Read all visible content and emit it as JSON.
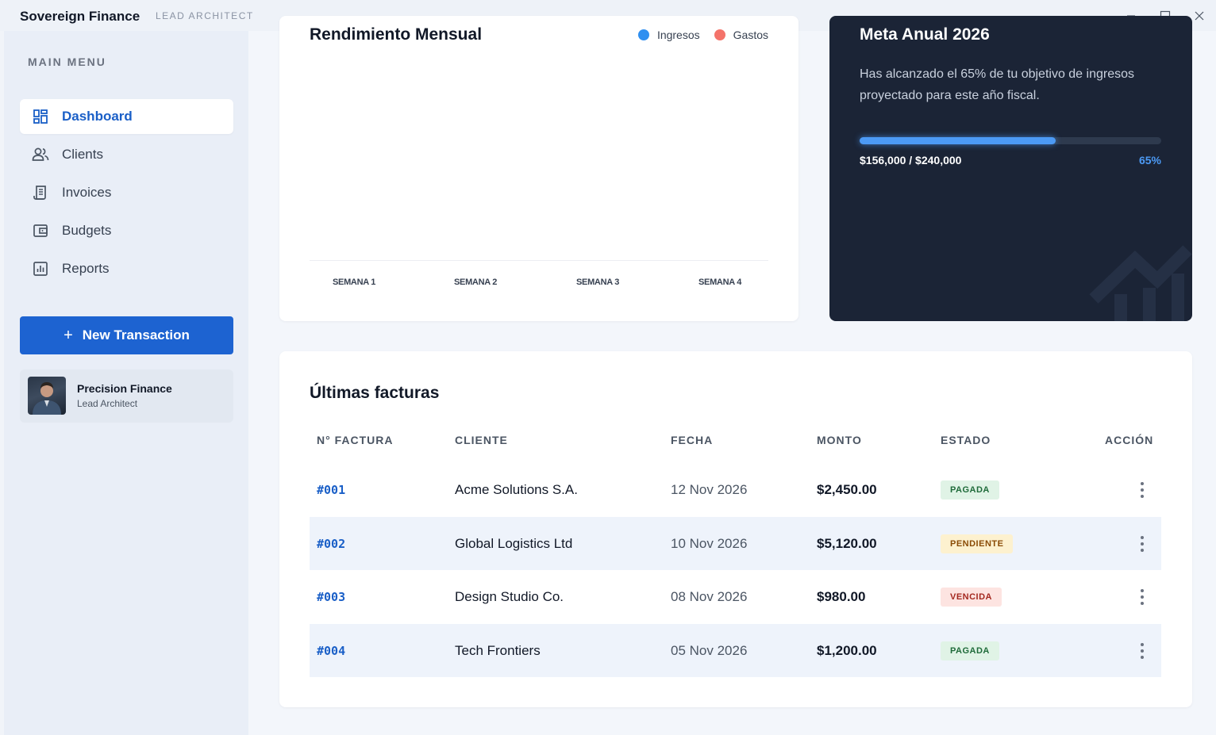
{
  "window": {
    "app_title": "Sovereign Finance",
    "app_subtitle": "LEAD ARCHITECT"
  },
  "sidebar": {
    "menu_title": "MAIN MENU",
    "items": [
      {
        "label": "Dashboard",
        "icon": "dashboard-icon",
        "active": true
      },
      {
        "label": "Clients",
        "icon": "users-icon",
        "active": false
      },
      {
        "label": "Invoices",
        "icon": "invoice-icon",
        "active": false
      },
      {
        "label": "Budgets",
        "icon": "wallet-icon",
        "active": false
      },
      {
        "label": "Reports",
        "icon": "chart-icon",
        "active": false
      }
    ],
    "new_button": "New Transaction",
    "profile": {
      "name": "Precision Finance",
      "role": "Lead Architect"
    }
  },
  "performance": {
    "title": "Rendimiento Mensual",
    "legend": [
      {
        "label": "Ingresos",
        "color": "#2f8ff0"
      },
      {
        "label": "Gastos",
        "color": "#f4736a"
      }
    ],
    "weeks": [
      "SEMANA 1",
      "SEMANA 2",
      "SEMANA 3",
      "SEMANA 4"
    ]
  },
  "goal": {
    "title": "Meta Anual 2026",
    "text": "Has alcanzado el 65% de tu objetivo de ingresos proyectado para este año fiscal.",
    "amount": "$156,000 / $240,000",
    "percent": "65%",
    "progress": 0.65
  },
  "invoices": {
    "title": "Últimas facturas",
    "headers": [
      "N° FACTURA",
      "CLIENTE",
      "FECHA",
      "MONTO",
      "ESTADO",
      "ACCIÓN"
    ],
    "rows": [
      {
        "id": "#001",
        "client": "Acme Solutions S.A.",
        "date": "12 Nov 2026",
        "amount": "$2,450.00",
        "status": "PAGADA"
      },
      {
        "id": "#002",
        "client": "Global Logistics Ltd",
        "date": "10 Nov 2026",
        "amount": "$5,120.00",
        "status": "PENDIENTE"
      },
      {
        "id": "#003",
        "client": "Design Studio Co.",
        "date": "08 Nov 2026",
        "amount": "$980.00",
        "status": "VENCIDA"
      },
      {
        "id": "#004",
        "client": "Tech Frontiers",
        "date": "05 Nov 2026",
        "amount": "$1,200.00",
        "status": "PAGADA"
      }
    ]
  },
  "colors": {
    "accent": "#1d63d1",
    "goal_bg": "#1b2436",
    "progress": "#4c9af5"
  }
}
